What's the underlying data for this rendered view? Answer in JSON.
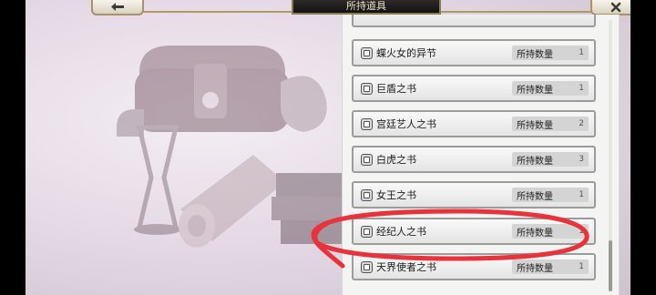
{
  "header": {
    "title": "所持道具"
  },
  "buttons": {
    "back_icon": "arrow-left-icon",
    "close_icon": "close-x-icon"
  },
  "items": [
    {
      "name": "",
      "qty_label": "",
      "qty": ""
    },
    {
      "name": "蝶火女的异节",
      "qty_label": "所持数量",
      "qty": "1"
    },
    {
      "name": "巨盾之书",
      "qty_label": "所持数量",
      "qty": "1"
    },
    {
      "name": "宫廷艺人之书",
      "qty_label": "所持数量",
      "qty": "2"
    },
    {
      "name": "白虎之书",
      "qty_label": "所持数量",
      "qty": "3"
    },
    {
      "name": "女王之书",
      "qty_label": "所持数量",
      "qty": "1"
    },
    {
      "name": "经纪人之书",
      "qty_label": "所持数量",
      "qty": "1"
    },
    {
      "name": "天界使者之书",
      "qty_label": "所持数量",
      "qty": "1"
    }
  ],
  "colors": {
    "annotation": "#e8323c",
    "header_gold": "#b09a63"
  }
}
